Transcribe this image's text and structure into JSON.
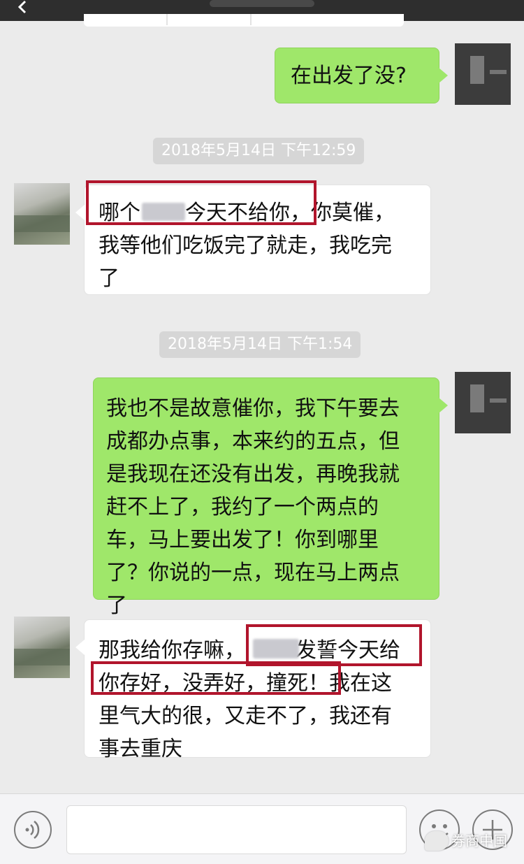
{
  "messages": [
    {
      "id": "m1",
      "side": "right",
      "text": "在出发了没?"
    },
    {
      "id": "m2",
      "side": "left",
      "lines": [
        "哪个▒▒今天不给你，你莫催，",
        "我等他们吃饭完了就走，我吃完",
        "了"
      ]
    },
    {
      "id": "m3",
      "side": "right",
      "lines": [
        "我也不是故意催你，我下午要去",
        "成都办点事，本来约的五点，但",
        "是我现在还没有出发，再晚我就",
        "赶不上了，我约了一个两点的",
        "车，马上要出发了！你到哪里",
        "了？你说的一点，现在马上两点",
        "了"
      ]
    },
    {
      "id": "m4",
      "side": "left",
      "lines": [
        "那我给你存嘛，▒▒▒发誓今天给",
        "你存好，没弄好，撞死！我在这",
        "里气大的很，又走不了，我还有",
        "事去重庆"
      ]
    }
  ],
  "timestamps": [
    "2018年5月14日 下午12:59",
    "2018年5月14日 下午1:54"
  ],
  "m2_line1": {
    "a": "哪个",
    "b": "今天不给你",
    "c": "，你莫催，"
  },
  "m4_line1": {
    "a": "那我给你存嘛，",
    "b": "发誓今天给"
  },
  "m4_line2": {
    "a": "你存好，没弄好，撞死！",
    "b": "我在这"
  },
  "watermark": "券商中国",
  "colors": {
    "sent_bubble": "#9fe76a",
    "received_bubble": "#ffffff",
    "highlight_box": "#b1152c",
    "background": "#ebebeb"
  },
  "icons": {
    "back": "chevron-left-icon",
    "voice": "voice-icon",
    "emoji": "smiley-icon",
    "plus": "plus-icon"
  }
}
